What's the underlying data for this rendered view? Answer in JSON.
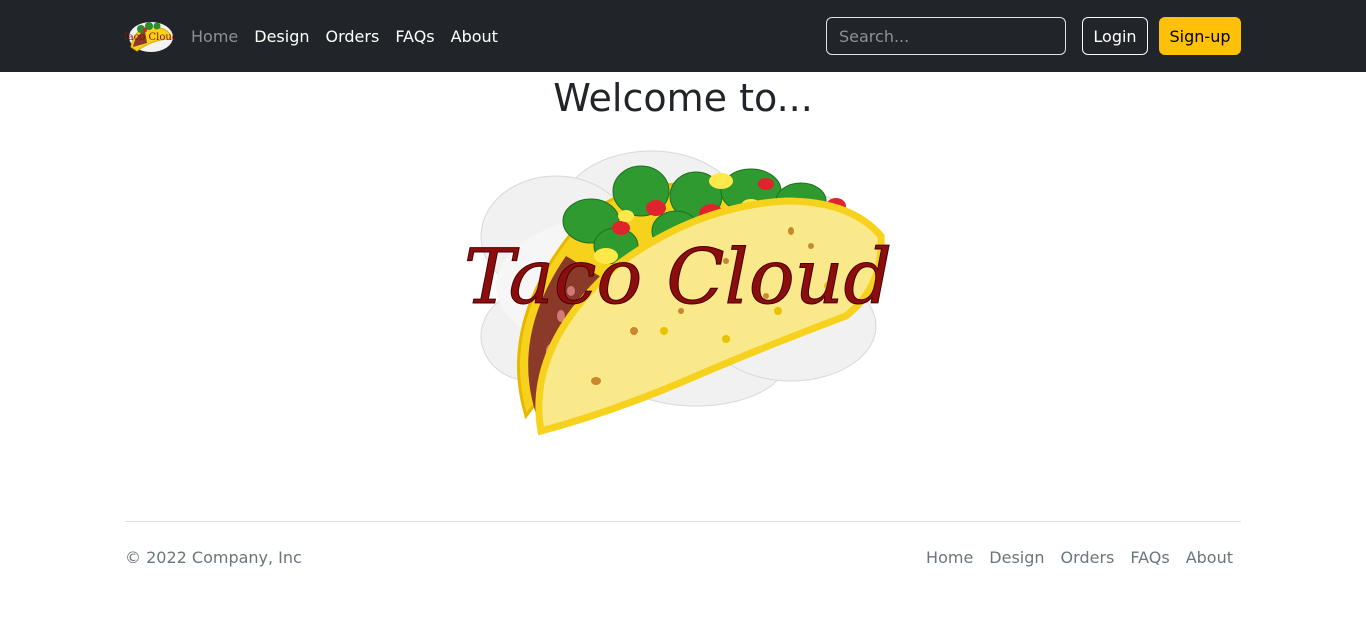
{
  "navbar": {
    "logo_text": "Taco Cloud",
    "links": [
      "Home",
      "Design",
      "Orders",
      "FAQs",
      "About"
    ],
    "search": {
      "placeholder": "Search...",
      "value": ""
    },
    "login_label": "Login",
    "signup_label": "Sign-up"
  },
  "main": {
    "heading": "Welcome to...",
    "logo_text": "Taco Cloud"
  },
  "footer": {
    "copyright": "© 2022 Company, Inc",
    "links": [
      "Home",
      "Design",
      "Orders",
      "FAQs",
      "About"
    ]
  },
  "colors": {
    "navbar_bg": "#212529",
    "accent": "#ffc107",
    "logo_text": "#8b0d0d",
    "taco_shell": "#f6d21c"
  }
}
